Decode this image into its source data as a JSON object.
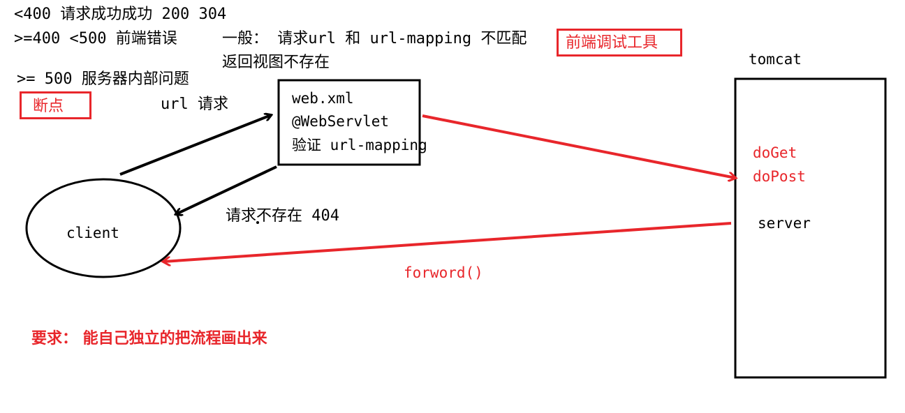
{
  "notes": {
    "line1": "<400 请求成功成功  200 304",
    "line2": ">=400 <500 前端错误",
    "line2_reason1": "一般： 请求url 和 url-mapping 不匹配",
    "line2_reason2": "返回视图不存在",
    "line3": ">= 500 服务器内部问题",
    "frontend_tool_badge": "前端调试工具",
    "breakpoint_badge": "断点"
  },
  "client": {
    "label": "client"
  },
  "request_arrow_label": "url 请求",
  "not_found_label": "请求不存在 404",
  "config_box": {
    "lines": [
      "web.xml",
      "@WebServlet",
      "验证 url-mapping"
    ]
  },
  "tomcat": {
    "title": "tomcat",
    "methods": [
      "doGet",
      "doPost"
    ],
    "server_label": "server"
  },
  "forward_label": "forword()",
  "requirement": "要求：  能自己独立的把流程画出来",
  "colors": {
    "red": "#e8262b",
    "black": "#000000"
  }
}
